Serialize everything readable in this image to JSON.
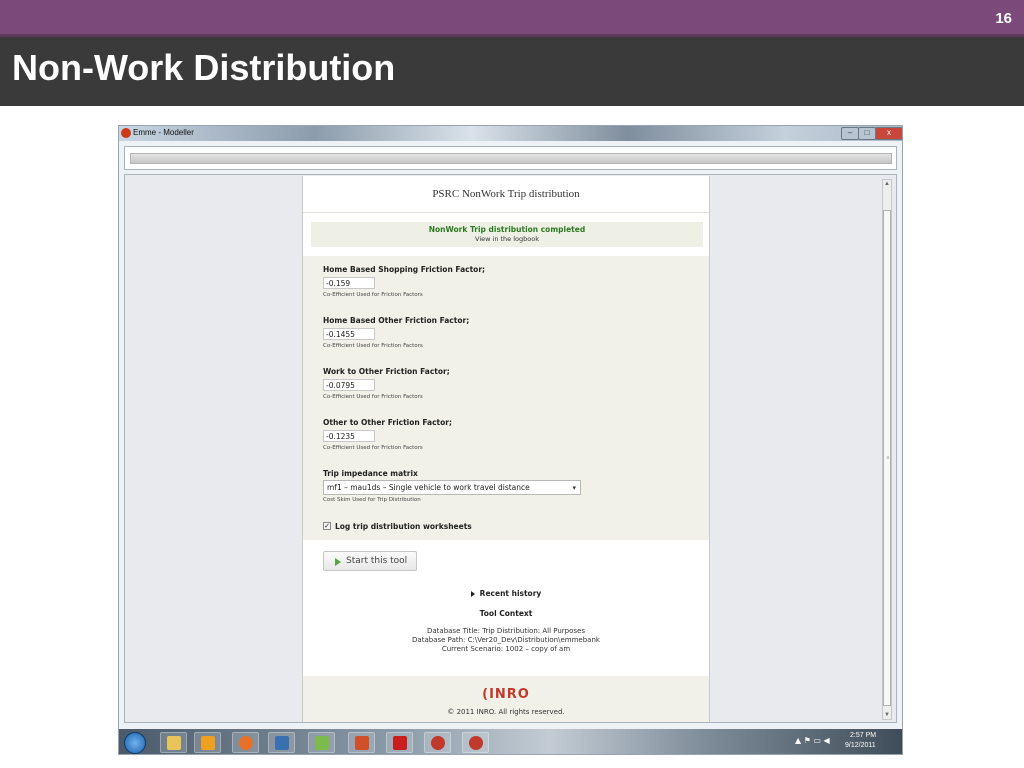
{
  "slide": {
    "number": "16",
    "title": "Non-Work Distribution"
  },
  "window": {
    "title": "Emme - Modeller",
    "min_glyph": "–",
    "max_glyph": "□",
    "close_glyph": "x"
  },
  "tool": {
    "title": "PSRC NonWork Trip distribution",
    "notice_title": "NonWork Trip distribution completed",
    "notice_link": "View in the logbook"
  },
  "fields": {
    "hbs": {
      "label": "Home Based Shopping Friction Factor;",
      "value": "-0.159",
      "hint": "Co-Efficient Used for Friction Factors"
    },
    "hbo": {
      "label": "Home Based Other Friction Factor;",
      "value": "-0.1455",
      "hint": "Co-Efficient Used for Friction Factors"
    },
    "wto": {
      "label": "Work to Other Friction Factor;",
      "value": "-0.0795",
      "hint": "Co-Efficient Used for Friction Factors"
    },
    "oto": {
      "label": "Other to Other Friction Factor;",
      "value": "-0.1235",
      "hint": "Co-Efficient Used for Friction Factors"
    }
  },
  "matrix": {
    "label": "Trip impedance matrix",
    "selected": "mf1 – mau1ds – Single vehicle to work travel distance",
    "hint": "Cost Skim Used for Trip Distribution"
  },
  "log_option": {
    "label": "Log trip distribution worksheets",
    "checked_glyph": "✓"
  },
  "start_button": {
    "label": "Start this tool"
  },
  "recent_history": "Recent history",
  "context": {
    "heading": "Tool Context",
    "db_title": "Database Title: Trip Distribution: All Purposes",
    "db_path": "Database Path: C:\\Ver20_Dev\\Distribution\\emmebank",
    "scenario": "Current Scenario: 1002 – copy of am"
  },
  "footer": {
    "logo": "INRO",
    "copyright": "© 2011 INRO. All rights reserved."
  },
  "scroll": {
    "up_glyph": "▲",
    "down_glyph": "▼",
    "grip_glyph": "≡"
  },
  "taskbar": {
    "tray_icons": "▲ ⚑ ▭ ◀",
    "time": "2:57 PM",
    "date": "9/12/2011"
  },
  "colors": {
    "slide_bar": "#7b4a7a",
    "title_bar": "#3a3a3a",
    "success": "#2b7a1f",
    "inro_red": "#c0392b"
  }
}
